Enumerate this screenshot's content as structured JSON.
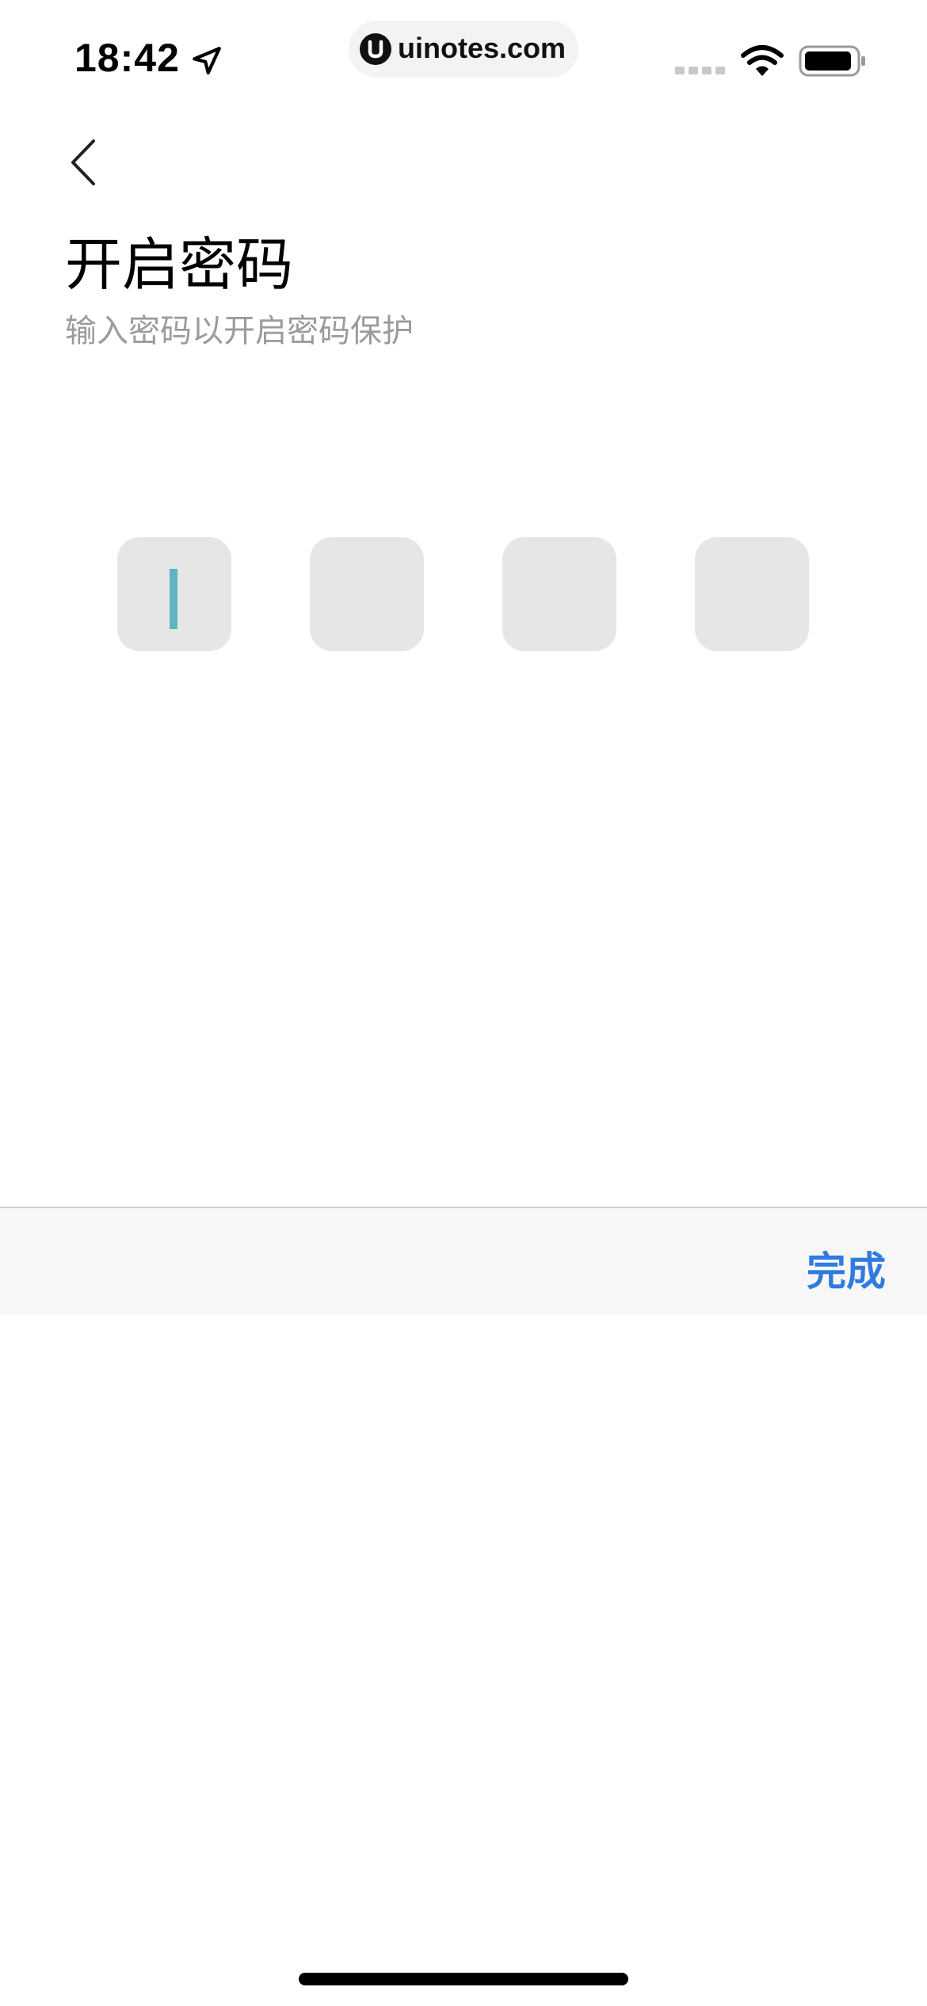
{
  "status_bar": {
    "time": "18:42",
    "url": "uinotes.com"
  },
  "header": {
    "title": "开启密码",
    "subtitle": "输入密码以开启密码保护"
  },
  "pin": {
    "length": 4,
    "filled": 0
  },
  "keyboard_toolbar": {
    "done_label": "完成"
  },
  "colors": {
    "accent": "#2f7be0",
    "cursor": "#5fb4c1",
    "box_bg": "#e6e6e6",
    "subtitle": "#9b9b9b"
  }
}
